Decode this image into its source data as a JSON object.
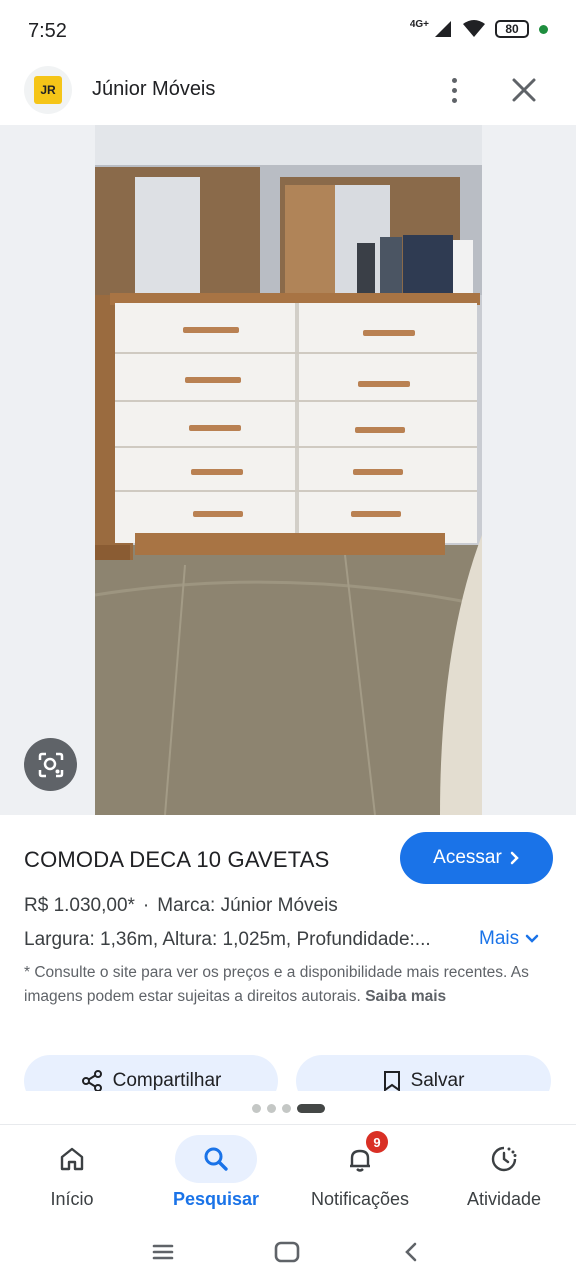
{
  "status_bar": {
    "time": "7:52",
    "network": "4G+",
    "battery": "80"
  },
  "header": {
    "logo_text": "JR",
    "source_name": "Júnior Móveis"
  },
  "product": {
    "title": "COMODA DECA 10 GAVETAS",
    "access_button": "Acessar",
    "price": "R$ 1.030,00*",
    "separator": "·",
    "brand": "Marca: Júnior Móveis",
    "description": "Largura: 1,36m, Altura: 1,025m, Profundidade:...",
    "more_link": "Mais",
    "disclaimer": "* Consulte o site para ver os preços e a disponibilidade mais recentes. As imagens podem estar sujeitas a direitos autorais.",
    "learn_more": "Saiba mais",
    "share_button": "Compartilhar",
    "save_button": "Salvar"
  },
  "pager": {
    "total": 4,
    "active_index": 3
  },
  "bottom_nav": {
    "items": [
      {
        "label": "Início",
        "icon": "home-icon"
      },
      {
        "label": "Pesquisar",
        "icon": "search-icon"
      },
      {
        "label": "Notificações",
        "icon": "bell-icon",
        "badge": "9"
      },
      {
        "label": "Atividade",
        "icon": "activity-icon"
      }
    ],
    "active_index": 1
  },
  "colors": {
    "accent": "#1a73e8",
    "badge": "#d93025",
    "pill_bg": "#e8f0fe"
  }
}
